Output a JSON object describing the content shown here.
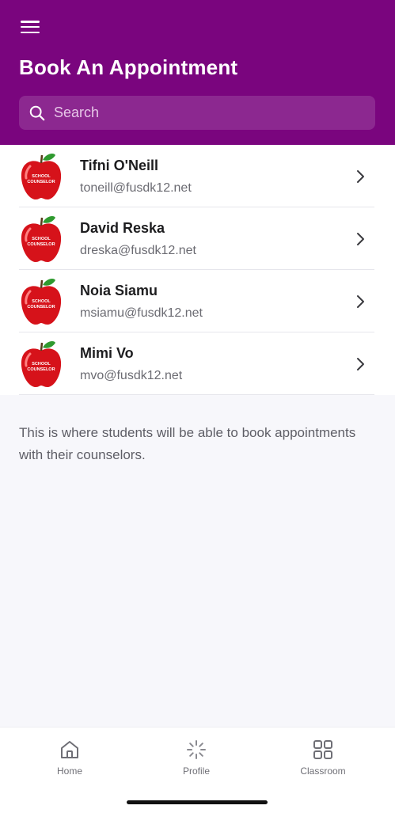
{
  "header": {
    "title": "Book An Appointment",
    "menu_icon": "hamburger-menu-icon",
    "background": "#7a057e"
  },
  "search": {
    "placeholder": "Search",
    "value": ""
  },
  "counselors": [
    {
      "name": "Tifni O'Neill",
      "email": "toneill@fusdk12.net",
      "avatar_text": [
        "SCHOOL",
        "COUNSELOR"
      ]
    },
    {
      "name": "David Reska",
      "email": "dreska@fusdk12.net",
      "avatar_text": [
        "SCHOOL",
        "COUNSELOR"
      ]
    },
    {
      "name": "Noia Siamu",
      "email": "msiamu@fusdk12.net",
      "avatar_text": [
        "SCHOOL",
        "COUNSELOR"
      ]
    },
    {
      "name": "Mimi Vo",
      "email": "mvo@fusdk12.net",
      "avatar_text": [
        "SCHOOL",
        "COUNSELOR"
      ]
    }
  ],
  "description": "This is where students will be able to book appointments with their counselors.",
  "bottom_nav": {
    "items": [
      {
        "label": "Home",
        "icon": "home-icon"
      },
      {
        "label": "Profile",
        "icon": "loading-spinner-icon"
      },
      {
        "label": "Classroom",
        "icon": "grid-icon"
      }
    ]
  }
}
